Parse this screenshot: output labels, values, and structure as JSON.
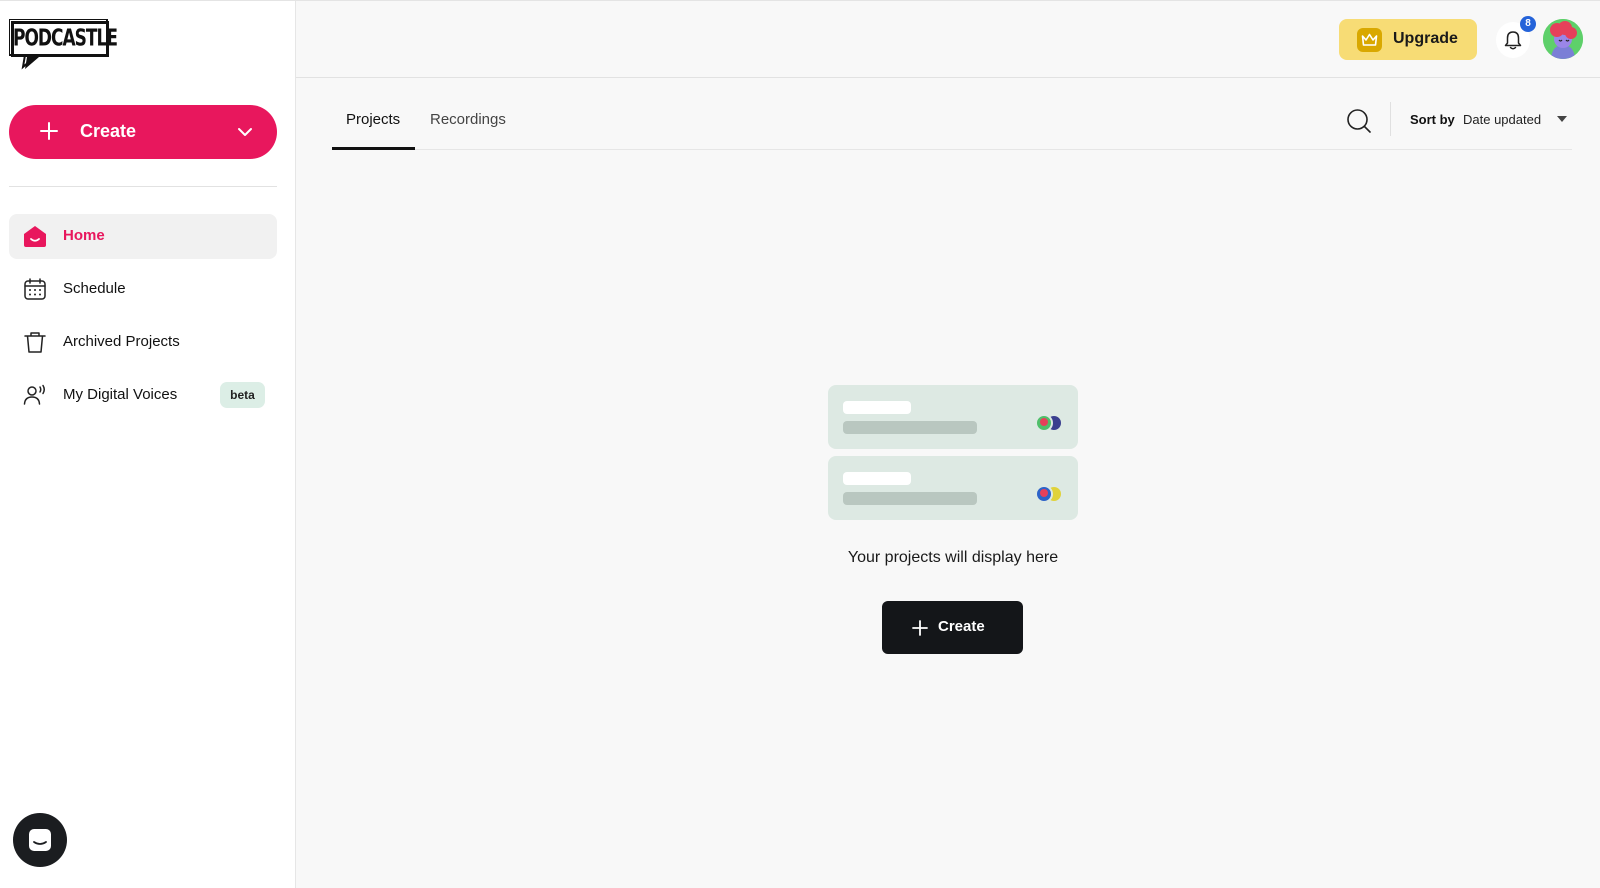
{
  "brand": {
    "logo_text": "PODCASTLE"
  },
  "sidebar": {
    "create_label": "Create",
    "items": [
      {
        "label": "Home",
        "icon": "home-icon",
        "active": true
      },
      {
        "label": "Schedule",
        "icon": "calendar-icon",
        "active": false
      },
      {
        "label": "Archived Projects",
        "icon": "trash-icon",
        "active": false
      },
      {
        "label": "My Digital Voices",
        "icon": "voice-user-icon",
        "active": false,
        "badge": "beta"
      }
    ]
  },
  "header": {
    "upgrade_label": "Upgrade",
    "notification_count": "8"
  },
  "main": {
    "tabs": [
      {
        "label": "Projects",
        "active": true
      },
      {
        "label": "Recordings",
        "active": false
      }
    ],
    "sort": {
      "label": "Sort by",
      "value": "Date updated"
    },
    "empty_state": {
      "message": "Your projects will display here",
      "create_label": "Create"
    }
  },
  "colors": {
    "accent": "#e8175d",
    "upgrade_bg": "#f7dc75",
    "dark_button": "#141619",
    "badge_bg": "#dceee6",
    "notif_badge": "#2563d9"
  }
}
